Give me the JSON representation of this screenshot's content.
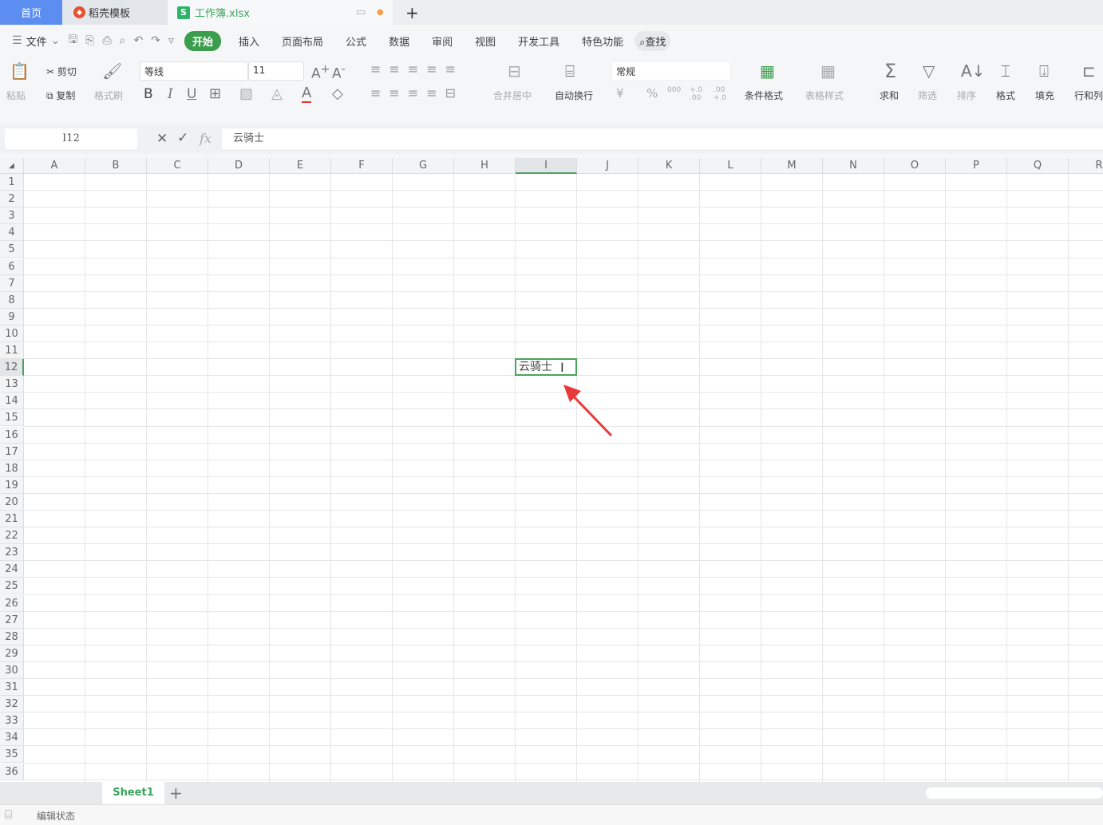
{
  "tabs": {
    "home": "首页",
    "daoke": "稻壳模板",
    "workbook": "工作簿.xlsx",
    "new_tab": "+"
  },
  "menu": {
    "file": "文件",
    "items": [
      "开始",
      "插入",
      "页面布局",
      "公式",
      "数据",
      "审阅",
      "视图",
      "开发工具",
      "特色功能"
    ],
    "search": "查找"
  },
  "ribbon": {
    "paste": "粘贴",
    "cut": "剪切",
    "copy": "复制",
    "format_painter": "格式刷",
    "font_name": "等线",
    "font_size": "11",
    "bold": "B",
    "italic": "I",
    "underline": "U",
    "merge_center": "合并居中",
    "wrap_text": "自动换行",
    "number_format": "常规",
    "currency": "¥",
    "percent": "%",
    "thousands": "000",
    "inc_decimal": "+.0 .00",
    "dec_decimal": ".00 +.0",
    "conditional_format": "条件格式",
    "table_style": "表格样式",
    "sum": "求和",
    "filter": "筛选",
    "sort": "排序",
    "format": "格式",
    "fill": "填充",
    "row_col": "行和列"
  },
  "formula_bar": {
    "name_box": "I12",
    "cancel": "✕",
    "confirm": "✓",
    "fx": "fx",
    "content": "云骑士"
  },
  "grid": {
    "columns": [
      "A",
      "B",
      "C",
      "D",
      "E",
      "F",
      "G",
      "H",
      "I",
      "J",
      "K",
      "L",
      "M",
      "N",
      "O",
      "P",
      "Q",
      "R"
    ],
    "rows": [
      "1",
      "2",
      "3",
      "4",
      "5",
      "6",
      "7",
      "8",
      "9",
      "10",
      "11",
      "12",
      "13",
      "14",
      "15",
      "16",
      "17",
      "18",
      "19",
      "20",
      "21",
      "22",
      "23",
      "24",
      "25",
      "26",
      "27",
      "28",
      "29",
      "30",
      "31",
      "32",
      "33",
      "34",
      "35",
      "36"
    ],
    "active_cell_value": "云骑士",
    "selected_column": "I",
    "selected_row": "12"
  },
  "sheets": {
    "items": [
      "Sheet1"
    ],
    "add": "+"
  },
  "status": {
    "text": "编辑状态"
  },
  "colors": {
    "accent": "#3b9e4c",
    "home_tab": "#5b8ef0",
    "arrow": "#e83a3a"
  }
}
